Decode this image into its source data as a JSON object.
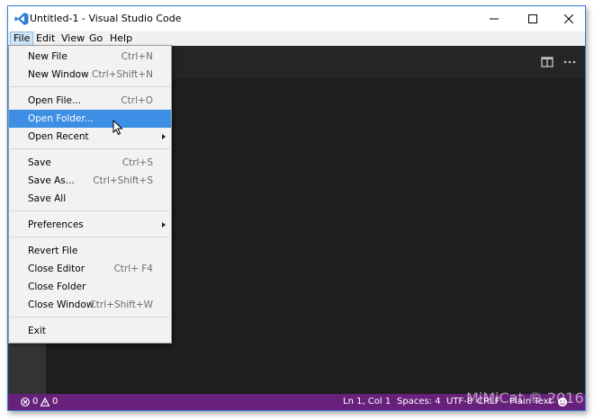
{
  "window": {
    "title": "Untitled-1 - Visual Studio Code"
  },
  "menubar": {
    "items": [
      "File",
      "Edit",
      "View",
      "Go",
      "Help"
    ]
  },
  "file_menu": {
    "items": [
      {
        "label": "New File",
        "shortcut": "Ctrl+N"
      },
      {
        "label": "New Window",
        "shortcut": "Ctrl+Shift+N"
      },
      {
        "label": "Open File...",
        "shortcut": "Ctrl+O"
      },
      {
        "label": "Open Folder...",
        "shortcut": ""
      },
      {
        "label": "Open Recent",
        "shortcut": ""
      },
      {
        "label": "Save",
        "shortcut": "Ctrl+S"
      },
      {
        "label": "Save As...",
        "shortcut": "Ctrl+Shift+S"
      },
      {
        "label": "Save All",
        "shortcut": ""
      },
      {
        "label": "Preferences",
        "shortcut": ""
      },
      {
        "label": "Revert File",
        "shortcut": ""
      },
      {
        "label": "Close Editor",
        "shortcut": "Ctrl+ F4"
      },
      {
        "label": "Close Folder",
        "shortcut": ""
      },
      {
        "label": "Close Window",
        "shortcut": "Ctrl+Shift+W"
      },
      {
        "label": "Exit",
        "shortcut": ""
      }
    ],
    "highlighted": "Open Folder..."
  },
  "statusbar": {
    "errors": "0",
    "warnings": "0",
    "position": "Ln 1, Col 1",
    "spaces": "Spaces: 4",
    "encoding": "UTF-8",
    "eol": "CRLF",
    "language": "Plain Text"
  },
  "watermark": "MiMiCat © 2016",
  "colors": {
    "statusbar": "#68217a",
    "editor_bg": "#1e1e1e",
    "menu_highlight": "#3c8fe4"
  },
  "icons": [
    "vscode-logo-icon",
    "minimize-icon",
    "maximize-icon",
    "close-icon",
    "split-editor-icon",
    "more-icon",
    "error-icon",
    "warning-icon",
    "feedback-icon",
    "mouse-cursor-icon"
  ]
}
